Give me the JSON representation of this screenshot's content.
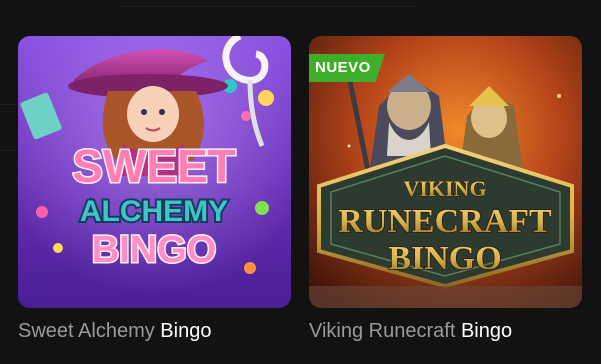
{
  "games": [
    {
      "id": "sweet-alchemy-bingo",
      "title_main": "Sweet Alchemy",
      "title_tail": "Bingo",
      "logo_lines": [
        "SWEET",
        "ALCHEMY",
        "BINGO"
      ],
      "badge": null
    },
    {
      "id": "viking-runecraft-bingo",
      "title_main": "Viking Runecraft",
      "title_tail": "Bingo",
      "logo_lines": [
        "VIKING",
        "RUNECRAFT",
        "BINGO"
      ],
      "badge": "NUEVO"
    }
  ],
  "colors": {
    "page_background": "#121212",
    "caption_dim": "#9a9a9a",
    "caption_bright": "#ffffff",
    "badge_new": "#3fae2a",
    "sweet_purple": "#7a3fbf",
    "viking_gold": "#d9b24c"
  }
}
